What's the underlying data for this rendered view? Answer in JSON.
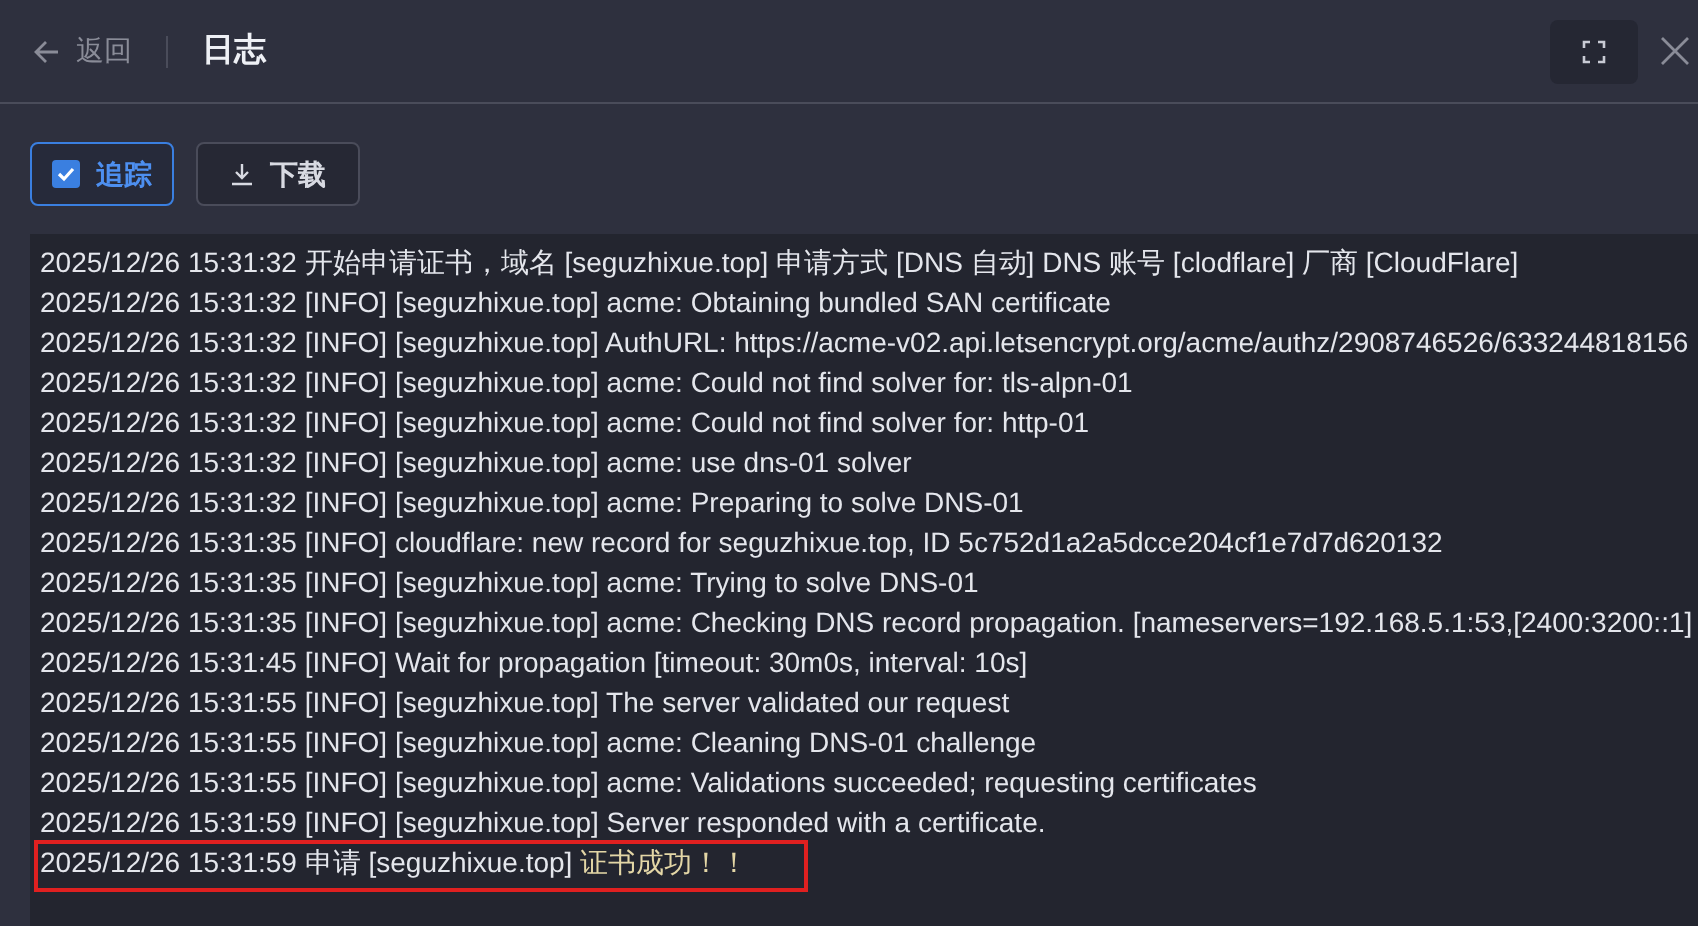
{
  "header": {
    "back": "返回",
    "title": "日志"
  },
  "toolbar": {
    "follow": {
      "label": "追踪",
      "checked": true
    },
    "download": {
      "label": "下载"
    }
  },
  "log": [
    {
      "text": "2025/12/26 15:31:32 开始申请证书，域名 [seguzhixue.top] 申请方式 [DNS 自动] DNS 账号 [clodflare] 厂商 [CloudFlare]"
    },
    {
      "text": "2025/12/26 15:31:32 [INFO] [seguzhixue.top] acme: Obtaining bundled SAN certificate"
    },
    {
      "text": "2025/12/26 15:31:32 [INFO] [seguzhixue.top] AuthURL: https://acme-v02.api.letsencrypt.org/acme/authz/2908746526/633244818156"
    },
    {
      "text": "2025/12/26 15:31:32 [INFO] [seguzhixue.top] acme: Could not find solver for: tls-alpn-01"
    },
    {
      "text": "2025/12/26 15:31:32 [INFO] [seguzhixue.top] acme: Could not find solver for: http-01"
    },
    {
      "text": "2025/12/26 15:31:32 [INFO] [seguzhixue.top] acme: use dns-01 solver"
    },
    {
      "text": "2025/12/26 15:31:32 [INFO] [seguzhixue.top] acme: Preparing to solve DNS-01"
    },
    {
      "text": "2025/12/26 15:31:35 [INFO] cloudflare: new record for seguzhixue.top, ID 5c752d1a2a5dcce204cf1e7d7d620132"
    },
    {
      "text": "2025/12/26 15:31:35 [INFO] [seguzhixue.top] acme: Trying to solve DNS-01"
    },
    {
      "text": "2025/12/26 15:31:35 [INFO] [seguzhixue.top] acme: Checking DNS record propagation. [nameservers=192.168.5.1:53,[2400:3200::1]"
    },
    {
      "text": "2025/12/26 15:31:45 [INFO] Wait for propagation [timeout: 30m0s, interval: 10s]"
    },
    {
      "text": "2025/12/26 15:31:55 [INFO] [seguzhixue.top] The server validated our request"
    },
    {
      "text": "2025/12/26 15:31:55 [INFO] [seguzhixue.top] acme: Cleaning DNS-01 challenge"
    },
    {
      "text": "2025/12/26 15:31:55 [INFO] [seguzhixue.top] acme: Validations succeeded; requesting certificates"
    },
    {
      "text": "2025/12/26 15:31:59 [INFO] [seguzhixue.top] Server responded with a certificate."
    },
    {
      "text": "2025/12/26 15:31:59 申请 [seguzhixue.top]",
      "status": "证书成功！！",
      "marked": true
    }
  ]
}
